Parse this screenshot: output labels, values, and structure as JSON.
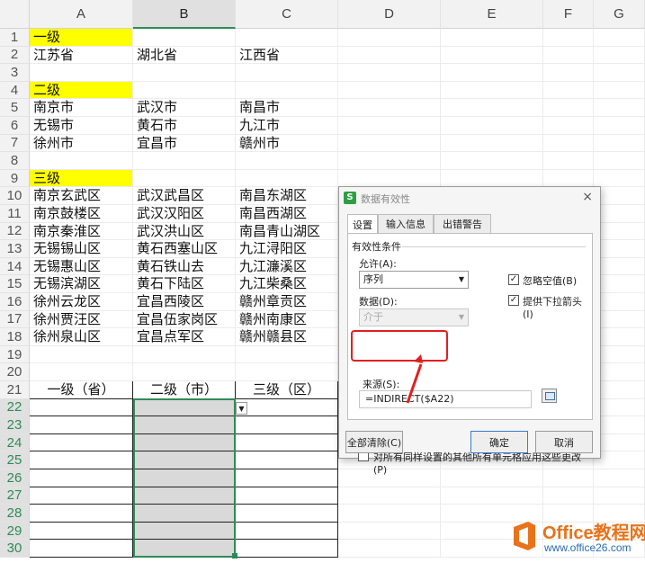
{
  "columns": [
    "A",
    "B",
    "C",
    "D",
    "E",
    "F",
    "G"
  ],
  "rows": [
    "1",
    "2",
    "3",
    "4",
    "5",
    "6",
    "7",
    "8",
    "9",
    "10",
    "11",
    "12",
    "13",
    "14",
    "15",
    "16",
    "17",
    "18",
    "19",
    "20",
    "21",
    "22",
    "23",
    "24",
    "25",
    "26",
    "27",
    "28",
    "29",
    "30"
  ],
  "cells": {
    "A1": "一级",
    "A2": "江苏省",
    "B2": "湖北省",
    "C2": "江西省",
    "A4": "二级",
    "A5": "南京市",
    "B5": "武汉市",
    "C5": "南昌市",
    "A6": "无锡市",
    "B6": "黄石市",
    "C6": "九江市",
    "A7": "徐州市",
    "B7": "宜昌市",
    "C7": "赣州市",
    "A9": "三级",
    "A10": "南京玄武区",
    "B10": "武汉武昌区",
    "C10": "南昌东湖区",
    "A11": "南京鼓楼区",
    "B11": "武汉汉阳区",
    "C11": "南昌西湖区",
    "A12": "南京秦淮区",
    "B12": "武汉洪山区",
    "C12": "南昌青山湖区",
    "A13": "无锡锡山区",
    "B13": "黄石西塞山区",
    "C13": "九江浔阳区",
    "A14": "无锡惠山区",
    "B14": "黄石铁山去",
    "C14": "九江濂溪区",
    "A15": "无锡滨湖区",
    "B15": "黄石下陆区",
    "C15": "九江柴桑区",
    "A16": "徐州云龙区",
    "B16": "宜昌西陵区",
    "C16": "赣州章贡区",
    "A17": "徐州贾汪区",
    "B17": "宜昌伍家岗区",
    "C17": "赣州南康区",
    "A18": "徐州泉山区",
    "B18": "宜昌点军区",
    "C18": "赣州赣县区",
    "A21": "一级（省）",
    "B21": "二级（市）",
    "C21": "三级（区）"
  },
  "dialog": {
    "app_icon": "S",
    "title": "数据有效性",
    "close": "×",
    "tabs": [
      "设置",
      "输入信息",
      "出错警告"
    ],
    "group_label": "有效性条件",
    "allow_label": "允许(A):",
    "allow_value": "序列",
    "data_label": "数据(D):",
    "data_value": "介于",
    "ignore_blank_label": "忽略空值(B)",
    "ignore_blank_checked": "✓",
    "dropdown_label": "提供下拉箭头(I)",
    "dropdown_checked": "✓",
    "source_label": "来源(S):",
    "source_value": "=INDIRECT($A22)",
    "apply_all_label": "对所有同样设置的其他所有单元格应用这些更改(P)",
    "clear_all": "全部清除(C)",
    "ok": "确定",
    "cancel": "取消"
  },
  "watermark": {
    "title": "Office教程网",
    "url": "www.office26.com"
  },
  "colors": {
    "accent": "#2e8b57",
    "highlight": "#ffff00",
    "annotation": "#e02020"
  }
}
